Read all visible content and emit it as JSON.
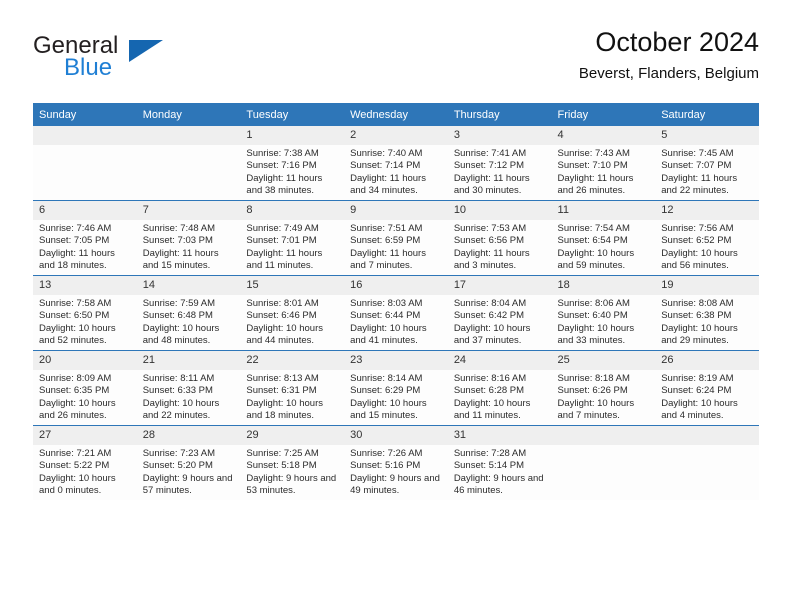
{
  "brand": {
    "name_part1": "General",
    "name_part2": "Blue",
    "accent_color": "#1566b0",
    "blue_text_color": "#1f7fd4"
  },
  "header": {
    "title": "October 2024",
    "subtitle": "Beverst, Flanders, Belgium"
  },
  "theme": {
    "header_bg": "#2e76b8",
    "daynum_bg": "#efefef",
    "cell_bg": "#fdfdfd",
    "row_divider": "#2e76b8"
  },
  "weekday_headers": [
    "Sunday",
    "Monday",
    "Tuesday",
    "Wednesday",
    "Thursday",
    "Friday",
    "Saturday"
  ],
  "labels": {
    "sunrise_prefix": "Sunrise:",
    "sunset_prefix": "Sunset:",
    "daylight_prefix": "Daylight:"
  },
  "weeks": [
    [
      {
        "day": "",
        "blank": true,
        "sunrise": "",
        "sunset": "",
        "daylight": ""
      },
      {
        "day": "",
        "blank": true,
        "sunrise": "",
        "sunset": "",
        "daylight": ""
      },
      {
        "day": "1",
        "blank": false,
        "sunrise": "Sunrise: 7:38 AM",
        "sunset": "Sunset: 7:16 PM",
        "daylight": "Daylight: 11 hours and 38 minutes."
      },
      {
        "day": "2",
        "blank": false,
        "sunrise": "Sunrise: 7:40 AM",
        "sunset": "Sunset: 7:14 PM",
        "daylight": "Daylight: 11 hours and 34 minutes."
      },
      {
        "day": "3",
        "blank": false,
        "sunrise": "Sunrise: 7:41 AM",
        "sunset": "Sunset: 7:12 PM",
        "daylight": "Daylight: 11 hours and 30 minutes."
      },
      {
        "day": "4",
        "blank": false,
        "sunrise": "Sunrise: 7:43 AM",
        "sunset": "Sunset: 7:10 PM",
        "daylight": "Daylight: 11 hours and 26 minutes."
      },
      {
        "day": "5",
        "blank": false,
        "sunrise": "Sunrise: 7:45 AM",
        "sunset": "Sunset: 7:07 PM",
        "daylight": "Daylight: 11 hours and 22 minutes."
      }
    ],
    [
      {
        "day": "6",
        "blank": false,
        "sunrise": "Sunrise: 7:46 AM",
        "sunset": "Sunset: 7:05 PM",
        "daylight": "Daylight: 11 hours and 18 minutes."
      },
      {
        "day": "7",
        "blank": false,
        "sunrise": "Sunrise: 7:48 AM",
        "sunset": "Sunset: 7:03 PM",
        "daylight": "Daylight: 11 hours and 15 minutes."
      },
      {
        "day": "8",
        "blank": false,
        "sunrise": "Sunrise: 7:49 AM",
        "sunset": "Sunset: 7:01 PM",
        "daylight": "Daylight: 11 hours and 11 minutes."
      },
      {
        "day": "9",
        "blank": false,
        "sunrise": "Sunrise: 7:51 AM",
        "sunset": "Sunset: 6:59 PM",
        "daylight": "Daylight: 11 hours and 7 minutes."
      },
      {
        "day": "10",
        "blank": false,
        "sunrise": "Sunrise: 7:53 AM",
        "sunset": "Sunset: 6:56 PM",
        "daylight": "Daylight: 11 hours and 3 minutes."
      },
      {
        "day": "11",
        "blank": false,
        "sunrise": "Sunrise: 7:54 AM",
        "sunset": "Sunset: 6:54 PM",
        "daylight": "Daylight: 10 hours and 59 minutes."
      },
      {
        "day": "12",
        "blank": false,
        "sunrise": "Sunrise: 7:56 AM",
        "sunset": "Sunset: 6:52 PM",
        "daylight": "Daylight: 10 hours and 56 minutes."
      }
    ],
    [
      {
        "day": "13",
        "blank": false,
        "sunrise": "Sunrise: 7:58 AM",
        "sunset": "Sunset: 6:50 PM",
        "daylight": "Daylight: 10 hours and 52 minutes."
      },
      {
        "day": "14",
        "blank": false,
        "sunrise": "Sunrise: 7:59 AM",
        "sunset": "Sunset: 6:48 PM",
        "daylight": "Daylight: 10 hours and 48 minutes."
      },
      {
        "day": "15",
        "blank": false,
        "sunrise": "Sunrise: 8:01 AM",
        "sunset": "Sunset: 6:46 PM",
        "daylight": "Daylight: 10 hours and 44 minutes."
      },
      {
        "day": "16",
        "blank": false,
        "sunrise": "Sunrise: 8:03 AM",
        "sunset": "Sunset: 6:44 PM",
        "daylight": "Daylight: 10 hours and 41 minutes."
      },
      {
        "day": "17",
        "blank": false,
        "sunrise": "Sunrise: 8:04 AM",
        "sunset": "Sunset: 6:42 PM",
        "daylight": "Daylight: 10 hours and 37 minutes."
      },
      {
        "day": "18",
        "blank": false,
        "sunrise": "Sunrise: 8:06 AM",
        "sunset": "Sunset: 6:40 PM",
        "daylight": "Daylight: 10 hours and 33 minutes."
      },
      {
        "day": "19",
        "blank": false,
        "sunrise": "Sunrise: 8:08 AM",
        "sunset": "Sunset: 6:38 PM",
        "daylight": "Daylight: 10 hours and 29 minutes."
      }
    ],
    [
      {
        "day": "20",
        "blank": false,
        "sunrise": "Sunrise: 8:09 AM",
        "sunset": "Sunset: 6:35 PM",
        "daylight": "Daylight: 10 hours and 26 minutes."
      },
      {
        "day": "21",
        "blank": false,
        "sunrise": "Sunrise: 8:11 AM",
        "sunset": "Sunset: 6:33 PM",
        "daylight": "Daylight: 10 hours and 22 minutes."
      },
      {
        "day": "22",
        "blank": false,
        "sunrise": "Sunrise: 8:13 AM",
        "sunset": "Sunset: 6:31 PM",
        "daylight": "Daylight: 10 hours and 18 minutes."
      },
      {
        "day": "23",
        "blank": false,
        "sunrise": "Sunrise: 8:14 AM",
        "sunset": "Sunset: 6:29 PM",
        "daylight": "Daylight: 10 hours and 15 minutes."
      },
      {
        "day": "24",
        "blank": false,
        "sunrise": "Sunrise: 8:16 AM",
        "sunset": "Sunset: 6:28 PM",
        "daylight": "Daylight: 10 hours and 11 minutes."
      },
      {
        "day": "25",
        "blank": false,
        "sunrise": "Sunrise: 8:18 AM",
        "sunset": "Sunset: 6:26 PM",
        "daylight": "Daylight: 10 hours and 7 minutes."
      },
      {
        "day": "26",
        "blank": false,
        "sunrise": "Sunrise: 8:19 AM",
        "sunset": "Sunset: 6:24 PM",
        "daylight": "Daylight: 10 hours and 4 minutes."
      }
    ],
    [
      {
        "day": "27",
        "blank": false,
        "sunrise": "Sunrise: 7:21 AM",
        "sunset": "Sunset: 5:22 PM",
        "daylight": "Daylight: 10 hours and 0 minutes."
      },
      {
        "day": "28",
        "blank": false,
        "sunrise": "Sunrise: 7:23 AM",
        "sunset": "Sunset: 5:20 PM",
        "daylight": "Daylight: 9 hours and 57 minutes."
      },
      {
        "day": "29",
        "blank": false,
        "sunrise": "Sunrise: 7:25 AM",
        "sunset": "Sunset: 5:18 PM",
        "daylight": "Daylight: 9 hours and 53 minutes."
      },
      {
        "day": "30",
        "blank": false,
        "sunrise": "Sunrise: 7:26 AM",
        "sunset": "Sunset: 5:16 PM",
        "daylight": "Daylight: 9 hours and 49 minutes."
      },
      {
        "day": "31",
        "blank": false,
        "sunrise": "Sunrise: 7:28 AM",
        "sunset": "Sunset: 5:14 PM",
        "daylight": "Daylight: 9 hours and 46 minutes."
      },
      {
        "day": "",
        "blank": true,
        "sunrise": "",
        "sunset": "",
        "daylight": ""
      },
      {
        "day": "",
        "blank": true,
        "sunrise": "",
        "sunset": "",
        "daylight": ""
      }
    ]
  ]
}
